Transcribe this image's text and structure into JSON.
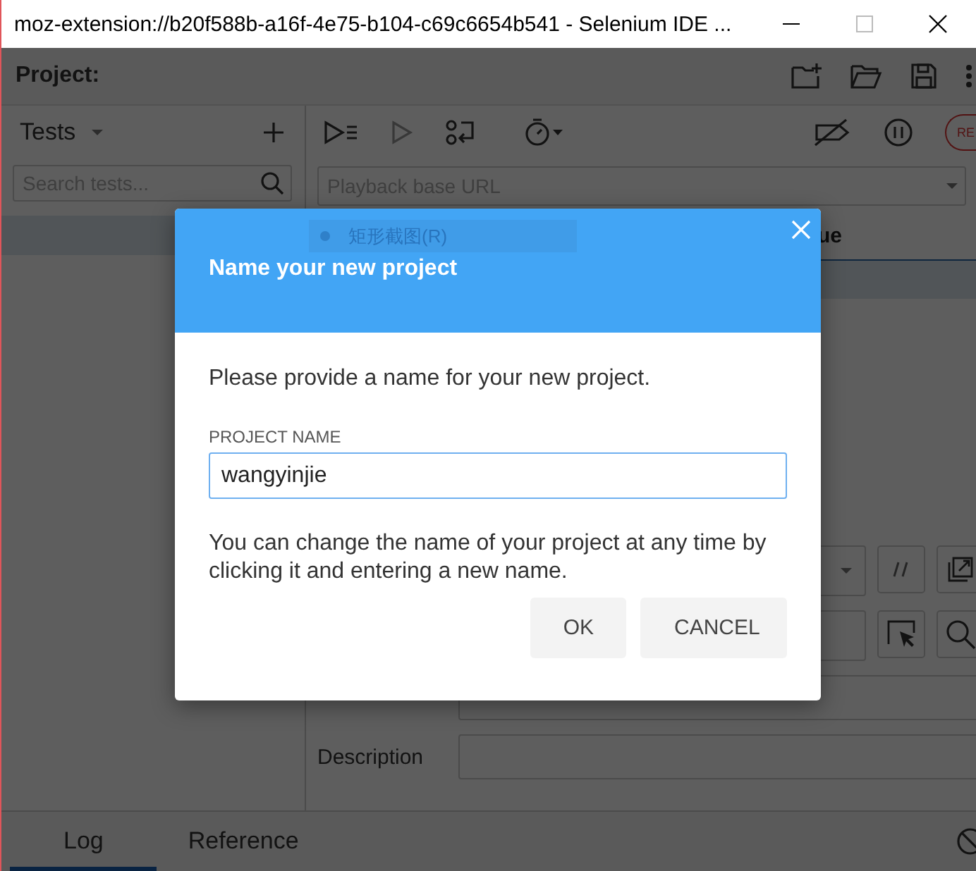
{
  "window": {
    "title": "moz-extension://b20f588b-a16f-4e75-b104-c69c6654b541 - Selenium IDE ..."
  },
  "project": {
    "label": "Project:"
  },
  "tests_panel": {
    "title": "Tests",
    "search": {
      "placeholder": "Search tests..."
    }
  },
  "toolbar": {
    "record_label": "RE"
  },
  "base_url": {
    "placeholder": "Playback base URL"
  },
  "table": {
    "columns": [
      "ue"
    ]
  },
  "command_editor": {
    "fields": [
      {
        "label": "Description"
      }
    ]
  },
  "bottom_tabs": [
    {
      "label": "Log",
      "selected": true
    },
    {
      "label": "Reference",
      "selected": false
    }
  ],
  "tooltip": {
    "text": "矩形截图(R)"
  },
  "dialog": {
    "title": "Name your new project",
    "message": "Please provide a name for your new project.",
    "field": {
      "label": "PROJECT NAME",
      "value": "wangyinjie"
    },
    "note": "You can change the name of your project at any time by clicking it and entering a new name.",
    "buttons": [
      {
        "label": "OK"
      },
      {
        "label": "CANCEL"
      }
    ]
  }
}
